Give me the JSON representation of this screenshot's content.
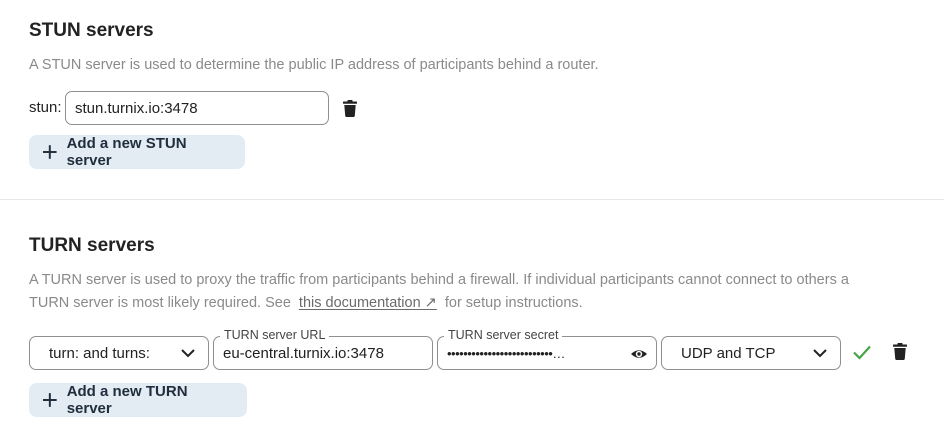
{
  "stun": {
    "title": "STUN servers",
    "description": "A STUN server is used to determine the public IP address of participants behind a router.",
    "label": "stun:",
    "server_value": "stun.turnix.io:3478",
    "add_label": "Add a new STUN server"
  },
  "turn": {
    "title": "TURN servers",
    "description_line1": "A TURN server is used to proxy the traffic from participants behind a firewall. If individual participants cannot connect to others a",
    "description_line2_pre": "TURN server is most likely required. See",
    "doc_link": "this documentation ↗",
    "description_line2_post": "for setup instructions.",
    "scheme_value": "turn: and turns:",
    "url_legend": "TURN server URL",
    "url_value": "eu-central.turnix.io:3478",
    "secret_legend": "TURN server secret",
    "secret_value": "••••••••••••••••••••••••••…",
    "protocol_value": "UDP and TCP",
    "add_label": "Add a new TURN server"
  },
  "colors": {
    "accent_check": "#46a546",
    "add_button_bg": "#e3ebf3"
  }
}
